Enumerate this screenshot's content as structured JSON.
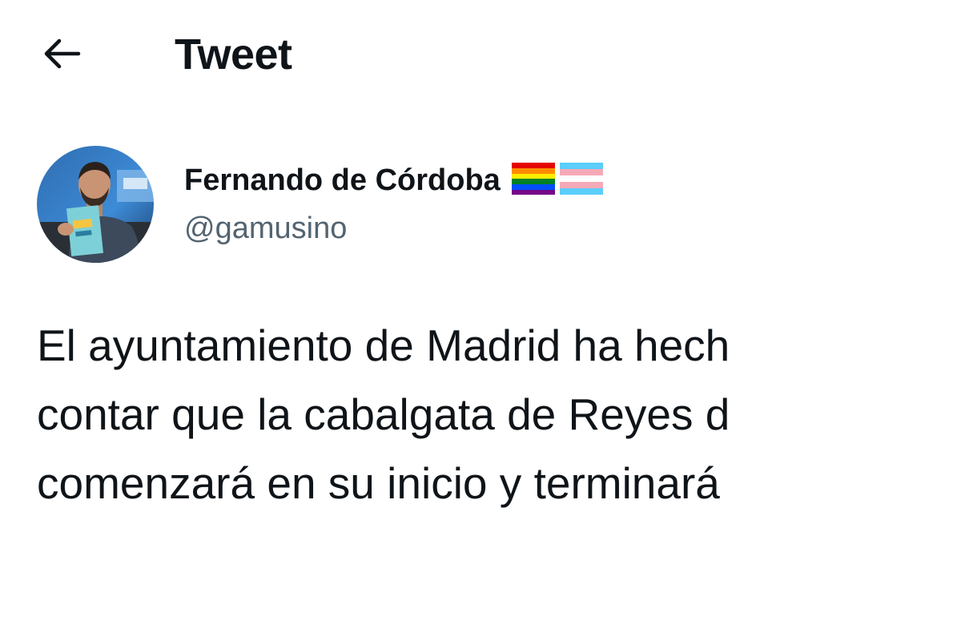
{
  "header": {
    "back_icon": "arrow-left-icon",
    "title": "Tweet"
  },
  "author": {
    "name": "Fernando de Córdoba",
    "handle": "@gamusino",
    "badges": [
      "rainbow-flag-icon",
      "transgender-flag-icon"
    ]
  },
  "tweet": {
    "lines": [
      "El ayuntamiento de Madrid ha hech",
      "contar que la cabalgata de Reyes d",
      "comenzará en su inicio y terminará"
    ]
  },
  "colors": {
    "text_primary": "#0f1419",
    "text_secondary": "#536471",
    "background": "#ffffff"
  }
}
